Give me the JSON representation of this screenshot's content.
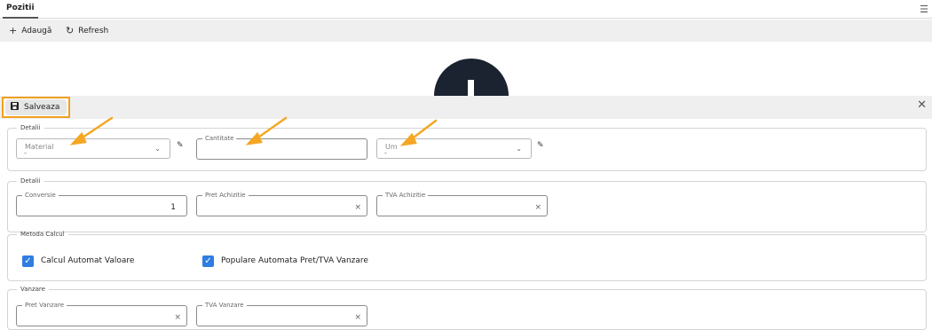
{
  "tabs": [
    {
      "label": "Pozitii"
    }
  ],
  "toolbar": {
    "add_label": "Adaugă",
    "refresh_label": "Refresh"
  },
  "form": {
    "save_label": "Salveaza",
    "sections": {
      "details1": {
        "legend": "Detalii",
        "material": {
          "label": "Material",
          "value": "-"
        },
        "cantitate": {
          "label": "Cantitate",
          "value": ""
        },
        "um": {
          "label": "Um",
          "value": "-"
        }
      },
      "details2": {
        "legend": "Detalii",
        "conversie": {
          "label": "Conversie",
          "value": "1"
        },
        "pret_achizitie": {
          "label": "Pret Achizitie",
          "value": ""
        },
        "tva_achizitie": {
          "label": "TVA Achizitie",
          "value": ""
        }
      },
      "metoda": {
        "legend": "Metoda Calcul",
        "calcul_automat": {
          "label": "Calcul Automat Valoare",
          "checked": true
        },
        "populare_automata": {
          "label": "Populare Automata Pret/TVA Vanzare",
          "checked": true
        }
      },
      "vanzare": {
        "legend": "Vanzare",
        "pret_vanzare": {
          "label": "Pret Vanzare",
          "value": ""
        },
        "tva_vanzare": {
          "label": "TVA Vanzare",
          "value": ""
        }
      }
    }
  },
  "colors": {
    "accent": "#f0a020",
    "checkbox": "#2f7de1",
    "logo": "#1b2330"
  }
}
